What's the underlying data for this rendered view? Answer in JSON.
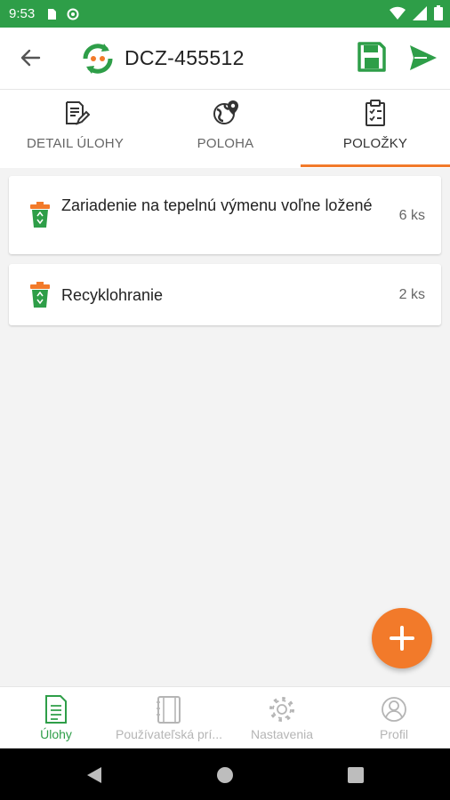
{
  "status_bar": {
    "time": "9:53"
  },
  "app_bar": {
    "title": "DCZ-455512"
  },
  "tabs": [
    {
      "label": "DETAIL ÚLOHY",
      "icon": "document-edit-icon"
    },
    {
      "label": "POLOHA",
      "icon": "globe-pin-icon"
    },
    {
      "label": "POLOŽKY",
      "icon": "clipboard-checklist-icon",
      "active": true
    }
  ],
  "items": [
    {
      "name": "Zariadenie na tepelnú výmenu voľne ložené",
      "qty": "6 ks",
      "icon": "recycle-bin-icon"
    },
    {
      "name": "Recyklohranie",
      "qty": "2 ks",
      "icon": "recycle-bin-icon"
    }
  ],
  "bottom_nav": [
    {
      "label": "Úlohy",
      "icon": "document-list-icon",
      "active": true
    },
    {
      "label": "Používateľská prí...",
      "icon": "notebook-icon"
    },
    {
      "label": "Nastavenia",
      "icon": "gear-icon"
    },
    {
      "label": "Profil",
      "icon": "user-icon"
    }
  ],
  "colors": {
    "status_bar": "#2e9e48",
    "accent": "#f27a2a",
    "primary_green": "#2e9e48"
  }
}
